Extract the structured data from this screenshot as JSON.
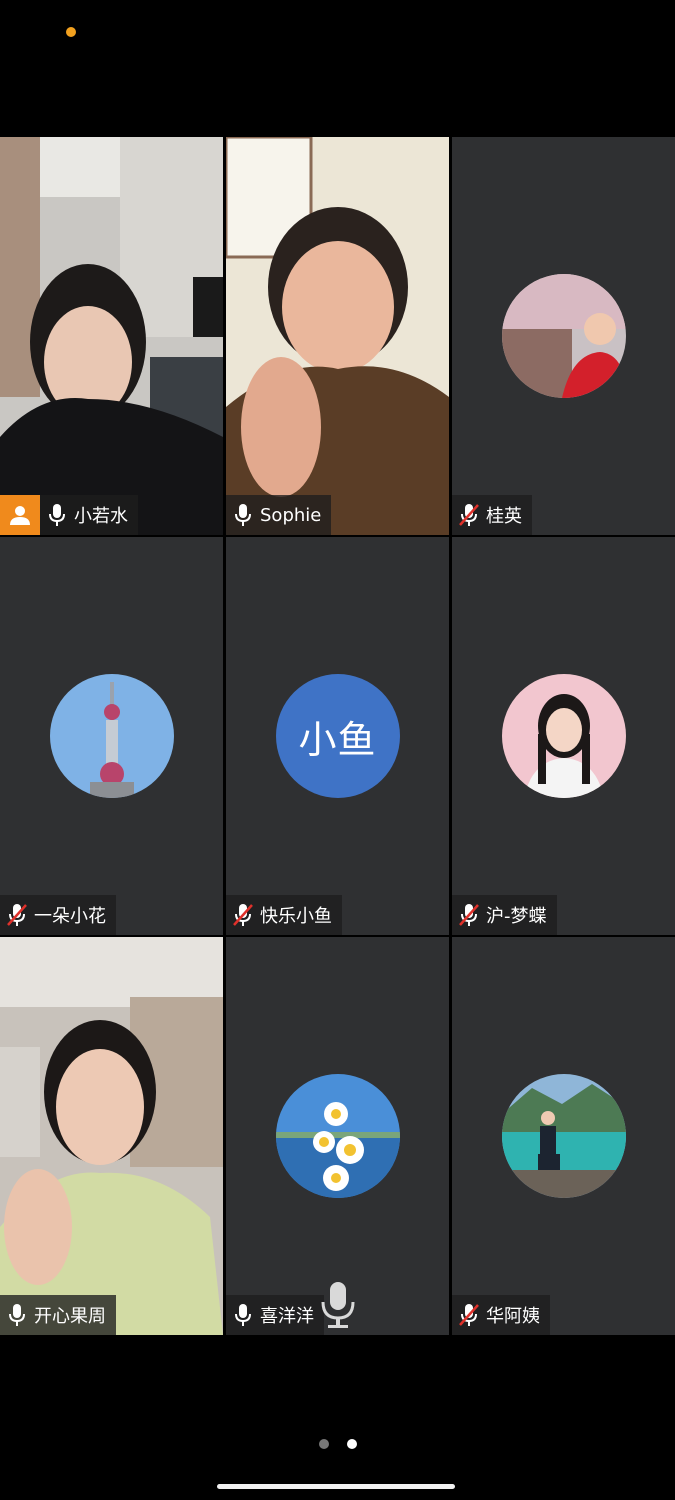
{
  "status": {
    "indicator_color": "#f2a11f"
  },
  "participants": [
    {
      "name": "小若水",
      "mic": "on",
      "video": true,
      "host": true
    },
    {
      "name": "Sophie",
      "mic": "on",
      "video": true
    },
    {
      "name": "桂英",
      "mic": "muted",
      "avatar": "photo"
    },
    {
      "name": "一朵小花",
      "mic": "muted",
      "avatar": "photo"
    },
    {
      "name": "快乐小鱼",
      "mic": "muted",
      "avatar_text": "小鱼",
      "avatar_color": "#3f73c6"
    },
    {
      "name": "沪-梦蝶",
      "mic": "muted",
      "avatar": "photo"
    },
    {
      "name": "开心果周",
      "mic": "on",
      "video": true,
      "active_speaker": true
    },
    {
      "name": "喜洋洋",
      "mic": "on",
      "avatar": "photo"
    },
    {
      "name": "华阿姨",
      "mic": "muted",
      "avatar": "photo"
    }
  ],
  "icons": {
    "mic_on": "microphone-icon",
    "mic_muted": "microphone-muted-icon",
    "host": "person-icon"
  },
  "pagination": {
    "total_pages": 2,
    "current_page": 2
  },
  "colors": {
    "tile_bg": "#2f3032",
    "active_border": "#2ea84f",
    "host_badge": "#f08a1c",
    "mute_red": "#e0312b"
  }
}
